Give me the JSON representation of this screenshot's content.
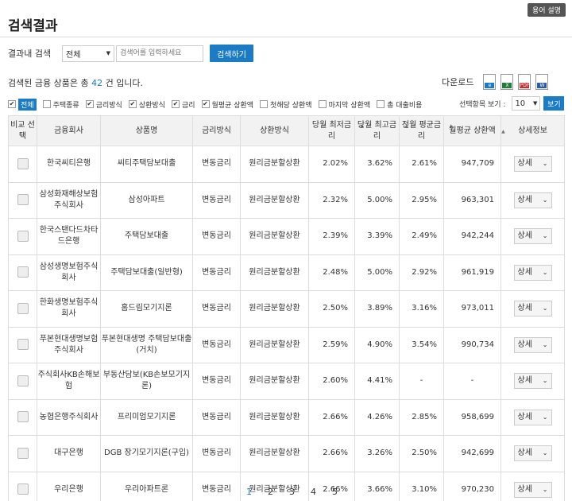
{
  "help_label": "용어 설명",
  "page_title": "검색결과",
  "search": {
    "label": "결과내 검색",
    "scope_value": "전체",
    "placeholder": "검색어를 입력하세요",
    "button": "검색하기"
  },
  "result": {
    "prefix": "검색된 금융 상품은 총 ",
    "count": "42",
    "suffix": " 건 입니다."
  },
  "download": {
    "label": "다운로드",
    "icons": [
      "ie-icon",
      "excel-icon",
      "pdf-icon",
      "word-icon"
    ],
    "icon_texts": [
      "e",
      "X",
      "PDF",
      "W"
    ]
  },
  "filters": [
    {
      "label": "전체",
      "checked": true
    },
    {
      "label": "주택종류",
      "checked": false
    },
    {
      "label": "금리방식",
      "checked": true
    },
    {
      "label": "상환방식",
      "checked": true
    },
    {
      "label": "금리",
      "checked": true
    },
    {
      "label": "월평균 상환액",
      "checked": true
    },
    {
      "label": "첫해당 상환액",
      "checked": false
    },
    {
      "label": "마지막 상환액",
      "checked": false
    },
    {
      "label": "총 대출비용",
      "checked": false
    }
  ],
  "per_page": {
    "label": "선택항목 보기 :",
    "value": "10",
    "button": "보기"
  },
  "table": {
    "headers": {
      "compare": "비교 선택",
      "company": "금융회사",
      "product": "상품명",
      "rate_type": "금리방식",
      "repay_type": "상환방식",
      "min_rate": "당월 최저금리",
      "max_rate": "당월 최고금리",
      "avg_rate": "전월 평균금리",
      "monthly": "월평균 상환액",
      "detail": "상세정보"
    },
    "rows": [
      {
        "company": "한국씨티은행",
        "product": "씨티주택담보대출",
        "rate_type": "변동금리",
        "repay_type": "원리금분할상환",
        "min_rate": "2.02%",
        "max_rate": "3.62%",
        "avg_rate": "2.61%",
        "monthly": "947,709",
        "detail": "상세"
      },
      {
        "company": "삼성화재해상보험주식회사",
        "product": "삼성아파트",
        "rate_type": "변동금리",
        "repay_type": "원리금분할상환",
        "min_rate": "2.32%",
        "max_rate": "5.00%",
        "avg_rate": "2.95%",
        "monthly": "963,301",
        "detail": "상세"
      },
      {
        "company": "한국스탠다드차타드은행",
        "product": "주택담보대출",
        "rate_type": "변동금리",
        "repay_type": "원리금분할상환",
        "min_rate": "2.39%",
        "max_rate": "3.39%",
        "avg_rate": "2.49%",
        "monthly": "942,244",
        "detail": "상세"
      },
      {
        "company": "삼성생명보험주식회사",
        "product": "주택담보대출(일반형)",
        "rate_type": "변동금리",
        "repay_type": "원리금분할상환",
        "min_rate": "2.48%",
        "max_rate": "5.00%",
        "avg_rate": "2.92%",
        "monthly": "961,919",
        "detail": "상세"
      },
      {
        "company": "한화생명보험주식회사",
        "product": "홈드림모기지론",
        "rate_type": "변동금리",
        "repay_type": "원리금분할상환",
        "min_rate": "2.50%",
        "max_rate": "3.89%",
        "avg_rate": "3.16%",
        "monthly": "973,011",
        "detail": "상세"
      },
      {
        "company": "푸본현대생명보험주식회사",
        "product": "푸본현대생명 주택담보대출(거치)",
        "rate_type": "변동금리",
        "repay_type": "원리금분할상환",
        "min_rate": "2.59%",
        "max_rate": "4.90%",
        "avg_rate": "3.54%",
        "monthly": "990,734",
        "detail": "상세"
      },
      {
        "company": "주식회사KB손해보험",
        "product": "부동산담보(KB손보모기지론)",
        "rate_type": "변동금리",
        "repay_type": "원리금분할상환",
        "min_rate": "2.60%",
        "max_rate": "4.41%",
        "avg_rate": "-",
        "monthly": "-",
        "detail": "상세"
      },
      {
        "company": "농협은행주식회사",
        "product": "프리미엄모기지론",
        "rate_type": "변동금리",
        "repay_type": "원리금분할상환",
        "min_rate": "2.66%",
        "max_rate": "4.26%",
        "avg_rate": "2.85%",
        "monthly": "958,699",
        "detail": "상세"
      },
      {
        "company": "대구은행",
        "product": "DGB 장기모기지론(구입)",
        "rate_type": "변동금리",
        "repay_type": "원리금분할상환",
        "min_rate": "2.66%",
        "max_rate": "3.26%",
        "avg_rate": "2.50%",
        "monthly": "942,699",
        "detail": "상세"
      },
      {
        "company": "우리은행",
        "product": "우리아파트론",
        "rate_type": "변동금리",
        "repay_type": "원리금분할상환",
        "min_rate": "2.66%",
        "max_rate": "3.66%",
        "avg_rate": "3.10%",
        "monthly": "970,230",
        "detail": "상세"
      }
    ]
  },
  "pagination": {
    "pages": [
      "1",
      "2",
      "3",
      "4",
      "5"
    ],
    "current": "1"
  },
  "colors": {
    "accent": "#1b7bc4"
  }
}
